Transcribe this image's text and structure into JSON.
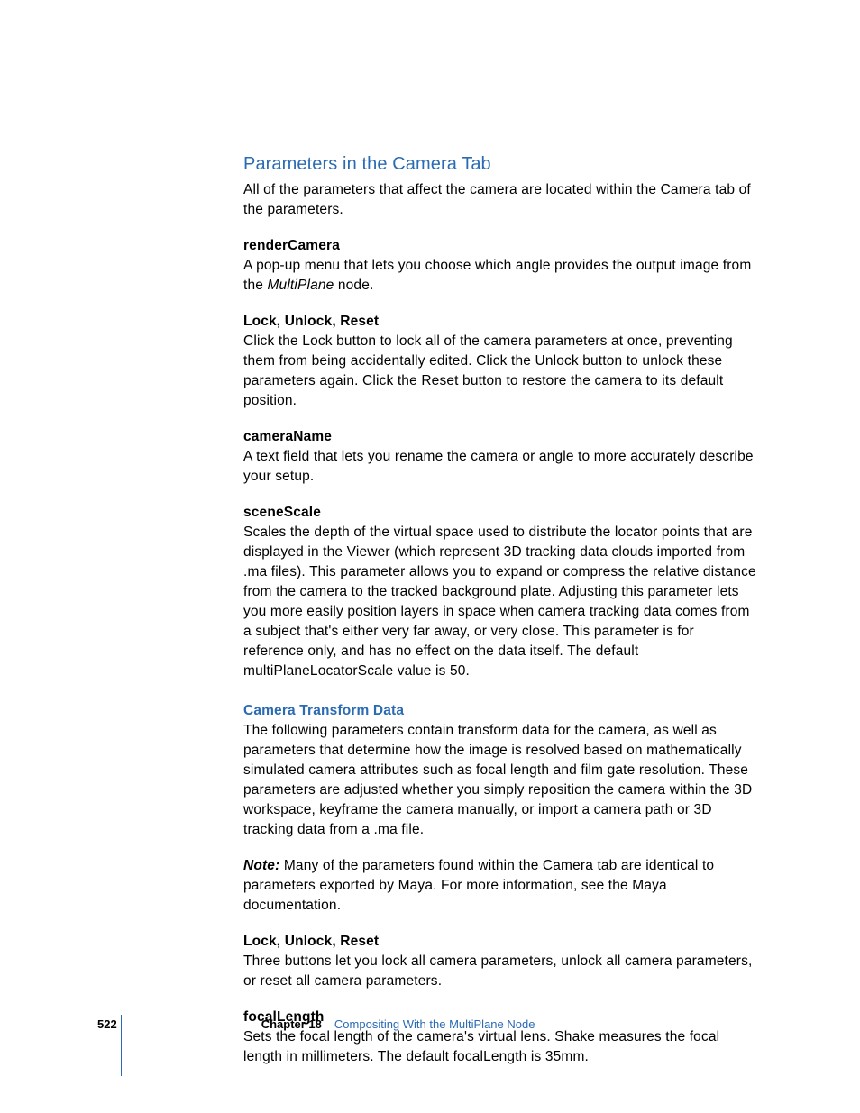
{
  "heading": "Parameters in the Camera Tab",
  "intro": "All of the parameters that affect the camera are located within the Camera tab of the parameters.",
  "params": {
    "renderCamera": {
      "name": "renderCamera",
      "desc_pre": "A pop-up menu that lets you choose which angle provides the output image from the ",
      "desc_italic": "MultiPlane",
      "desc_post": " node."
    },
    "lockUnlockReset1": {
      "name": "Lock, Unlock, Reset",
      "desc": "Click the Lock button to lock all of the camera parameters at once, preventing them from being accidentally edited. Click the Unlock button to unlock these parameters again. Click the Reset button to restore the camera to its default position."
    },
    "cameraName": {
      "name": "cameraName",
      "desc": "A text field that lets you rename the camera or angle to more accurately describe your setup."
    },
    "sceneScale": {
      "name": "sceneScale",
      "desc": "Scales the depth of the virtual space used to distribute the locator points that are displayed in the Viewer (which represent 3D tracking data clouds imported from .ma files). This parameter allows you to expand or compress the relative distance from the camera to the tracked background plate. Adjusting this parameter lets you more easily position layers in space when camera tracking data comes from a subject that's either very far away, or very close. This parameter is for reference only, and has no effect on the data itself. The default multiPlaneLocatorScale value is 50."
    }
  },
  "subheading": "Camera Transform Data",
  "subdesc": "The following parameters contain transform data for the camera, as well as parameters that determine how the image is resolved based on mathematically simulated camera attributes such as focal length and film gate resolution. These parameters are adjusted whether you simply reposition the camera within the 3D workspace, keyframe the camera manually, or import a camera path or 3D tracking data from a .ma file.",
  "note": {
    "label": "Note:",
    "text": "  Many of the parameters found within the Camera tab are identical to parameters exported by Maya. For more information, see the Maya documentation."
  },
  "params2": {
    "lockUnlockReset2": {
      "name": "Lock, Unlock, Reset",
      "desc": "Three buttons let you lock all camera parameters, unlock all camera parameters, or reset all camera parameters."
    },
    "focalLength": {
      "name": "focalLength",
      "desc": "Sets the focal length of the camera's virtual lens. Shake measures the focal length in millimeters. The default focalLength is 35mm."
    }
  },
  "footer": {
    "page": "522",
    "chapterLabel": "Chapter 18",
    "chapterTitle": "Compositing With the MultiPlane Node"
  }
}
